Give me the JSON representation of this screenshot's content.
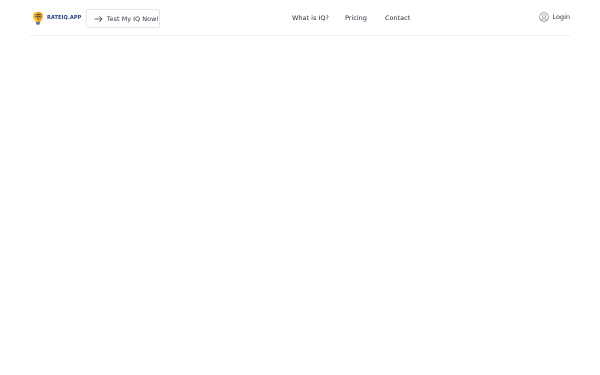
{
  "header": {
    "logo": {
      "text": "RATEIQ.APP",
      "icon": "brain-lightbulb-icon"
    },
    "cta": {
      "label": "Test My IQ Now!",
      "icon": "arrow-right-icon"
    },
    "nav": [
      {
        "label": "What is IQ?"
      },
      {
        "label": "Pricing"
      },
      {
        "label": "Contact"
      }
    ],
    "login": {
      "label": "Login",
      "icon": "user-circle-icon"
    }
  },
  "colors": {
    "brand": "#1e3a8a",
    "logo_orange": "#f59e0b",
    "border": "#eceef2",
    "text": "#1f2937"
  }
}
